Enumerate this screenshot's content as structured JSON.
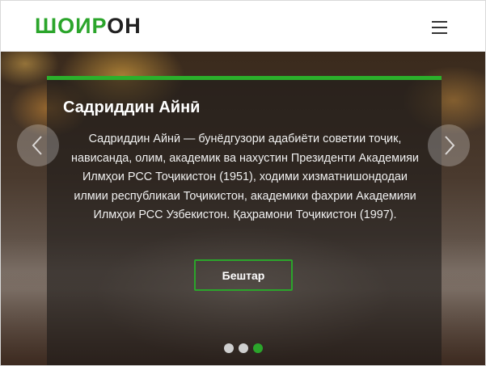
{
  "header": {
    "logo_green": "ШОИР",
    "logo_dark": "ОН",
    "menu_icon": "hamburger-menu-icon"
  },
  "slider": {
    "title": "Садриддин Айнӣ",
    "text": "Садриддин Айнӣ — бунёдгузори адабиёти советии тоҷик, нависанда, олим, академик ва нахустин Президенти Академияи Илмҳои РСС Тоҷикистон (1951), ходими хизматнишондодаи илмии республикаи Тоҷикистон, академики фахрии Академияи Илмҳои РСС Узбекистон. Қаҳрамони Тоҷикистон (1997).",
    "more_label": "Бештар",
    "prev_icon": "chevron-left-icon",
    "next_icon": "chevron-right-icon",
    "active_slide": 3,
    "slide_count": 3
  },
  "colors": {
    "accent": "#2ba52b",
    "overlay": "#1e1c1a"
  }
}
